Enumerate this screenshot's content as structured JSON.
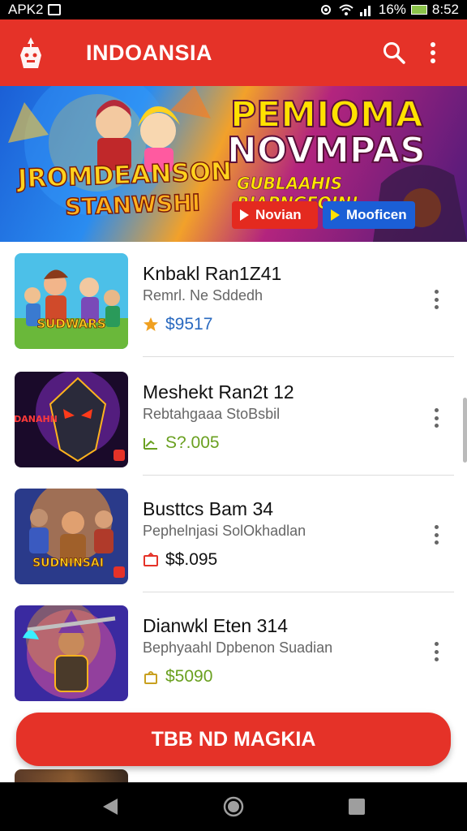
{
  "status_bar": {
    "app_label": "APK2",
    "battery_percent": "16%",
    "time": "8:52"
  },
  "app_bar": {
    "title": "INDOANSIA",
    "search_icon": "search-icon",
    "more_icon": "more-vert-icon"
  },
  "banner": {
    "left_title": "JROMDEANSON",
    "left_subtitle": "STANWSHI",
    "headline_line1": "PEMIOMA",
    "headline_line2": "NOVMPAS",
    "tagline": "GUBLAAHIS RIAPNGEOIN!",
    "button_primary": "Novian",
    "button_secondary": "Mooficen",
    "colors": {
      "primary_btn": "#e42a1f",
      "secondary_btn": "#1b5fd6"
    }
  },
  "games": [
    {
      "title": "Knbakl Ran1Z41",
      "subtitle": "Remrl. Ne Sddedh",
      "price": "$9517",
      "price_icon": "star-icon",
      "price_color": "#2a6ac0",
      "thumb_label": "SUDWARS"
    },
    {
      "title": "Meshekt Ran2t 12",
      "subtitle": "Rebtahgaaa StoBsbil",
      "price": "S?.005",
      "price_icon": "trend-icon",
      "price_color": "#6aa020",
      "thumb_label": "DANAHN"
    },
    {
      "title": "Busttcs Bam 34",
      "subtitle": "Pephelnjasi SolOkhadlan",
      "price": "$$.095",
      "price_icon": "ticket-icon",
      "price_color": "#111111",
      "thumb_label": "SUDNINSAI"
    },
    {
      "title": "Dianwkl Eten 314",
      "subtitle": "Bephyaahl Dpbenon Suadian",
      "price": "$5090",
      "price_icon": "bag-icon",
      "price_color": "#6aa020",
      "thumb_label": ""
    }
  ],
  "cta": {
    "label": "TBB ND MAGKIA"
  },
  "theme": {
    "accent": "#e53228",
    "divider": "#dddddd"
  }
}
